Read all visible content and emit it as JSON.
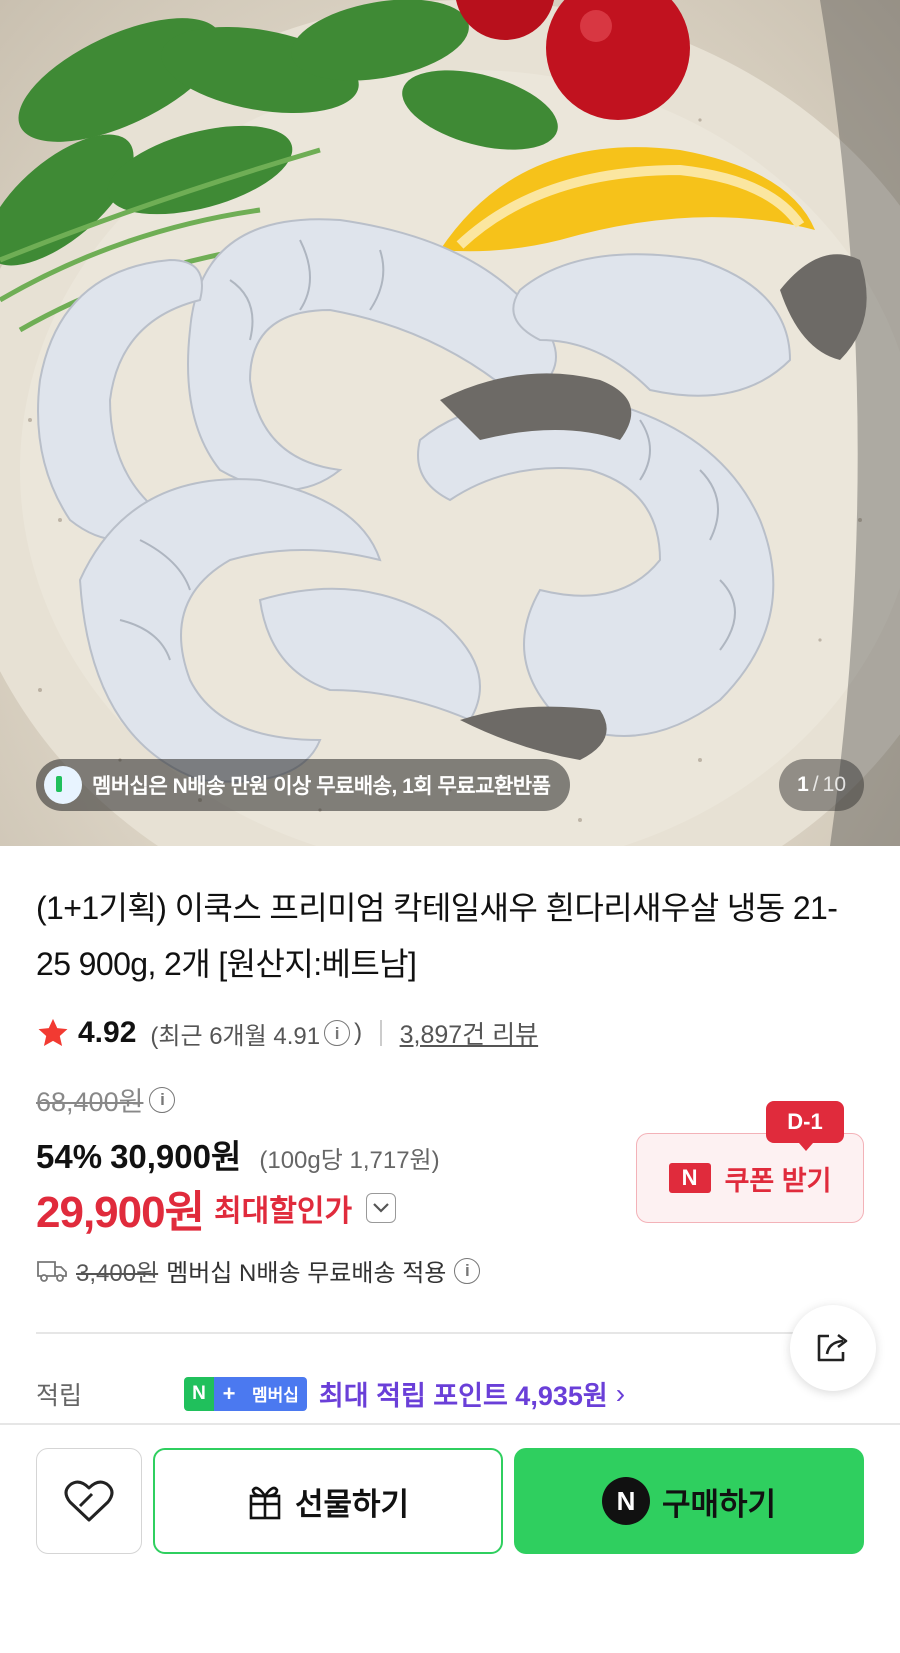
{
  "hero": {
    "banner_text": "멤버십은 N배송 만원 이상 무료배송, 1회 무료교환반품",
    "counter_current": "1",
    "counter_separator": "/",
    "counter_total": "10"
  },
  "product": {
    "title": "(1+1기획) 이쿡스 프리미엄 칵테일새우 흰다리새우살 냉동 21-25 900g, 2개 [원산지:베트남]",
    "rating": "4.92",
    "recent_rating_prefix": "(최근 6개월 4.91",
    "recent_rating_suffix": ")",
    "review_count": "3,897건 리뷰"
  },
  "price": {
    "original": "68,400원",
    "discount_percent": "54%",
    "sale_price": "30,900원",
    "unit_price": "(100g당 1,717원)",
    "max_discount_price": "29,900원",
    "max_discount_label": "최대할인가"
  },
  "coupon": {
    "dday": "D-1",
    "n_logo": "N",
    "label": "쿠폰 받기"
  },
  "shipping": {
    "fee": "3,400원",
    "text": "멤버십 N배송 무료배송 적용"
  },
  "points": {
    "label": "적립",
    "badge_n": "N",
    "badge_plus": "+",
    "badge_text": "멤버십",
    "text": "최대 적립 포인트 4,935원",
    "chevron": "›"
  },
  "actions": {
    "gift_label": "선물하기",
    "buy_n": "N",
    "buy_label": "구매하기"
  },
  "colors": {
    "accent_red": "#e02b3c",
    "naver_green": "#2fcf5f",
    "points_purple": "#6a3fd8",
    "membership_blue": "#4b79f0"
  }
}
